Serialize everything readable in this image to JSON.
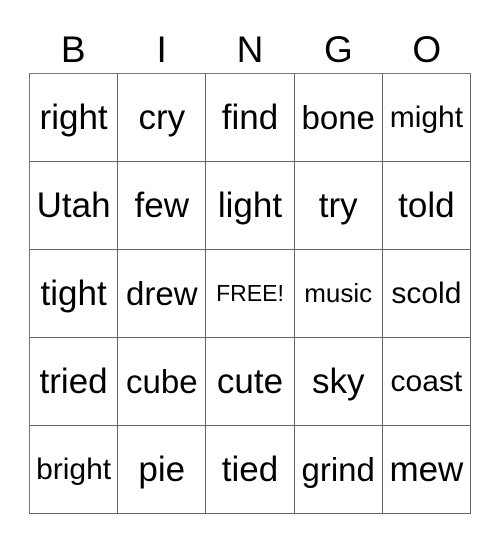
{
  "header": [
    "B",
    "I",
    "N",
    "G",
    "O"
  ],
  "rows": [
    [
      "right",
      "cry",
      "find",
      "bone",
      "might"
    ],
    [
      "Utah",
      "few",
      "light",
      "try",
      "told"
    ],
    [
      "tight",
      "drew",
      "FREE!",
      "music",
      "scold"
    ],
    [
      "tried",
      "cube",
      "cute",
      "sky",
      "coast"
    ],
    [
      "bright",
      "pie",
      "tied",
      "grind",
      "mew"
    ]
  ]
}
